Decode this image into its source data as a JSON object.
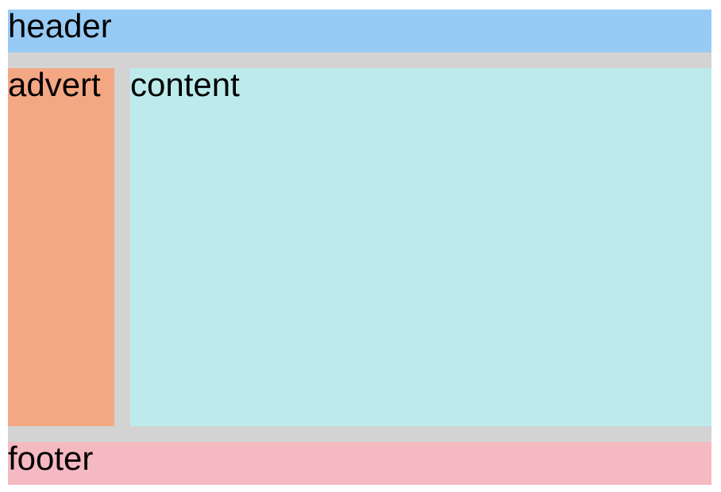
{
  "header": {
    "label": "header",
    "color": "#97cbf5"
  },
  "advert": {
    "label": "advert",
    "color": "#f3a783"
  },
  "content": {
    "label": "content",
    "color": "#bdebec"
  },
  "footer": {
    "label": "footer",
    "color": "#f5b9c1"
  },
  "layout": {
    "gap_color": "#d3d3d3"
  }
}
